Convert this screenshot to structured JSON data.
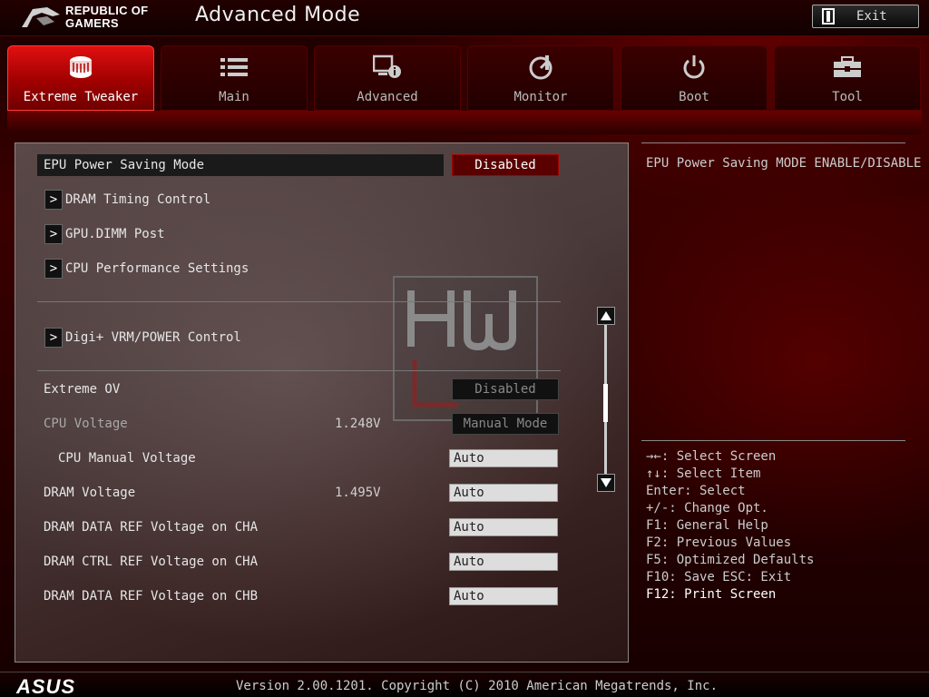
{
  "header": {
    "brand_line1": "REPUBLIC OF",
    "brand_line2": "GAMERS",
    "mode_title": "Advanced Mode",
    "exit_label": "Exit"
  },
  "tabs": [
    {
      "label": "Extreme Tweaker",
      "icon": "tweaker-icon",
      "active": true
    },
    {
      "label": "Main",
      "icon": "list-icon",
      "active": false
    },
    {
      "label": "Advanced",
      "icon": "advanced-icon",
      "active": false
    },
    {
      "label": "Monitor",
      "icon": "monitor-icon",
      "active": false
    },
    {
      "label": "Boot",
      "icon": "power-icon",
      "active": false
    },
    {
      "label": "Tool",
      "icon": "toolbox-icon",
      "active": false
    }
  ],
  "settings": {
    "epu_power": {
      "label": "EPU Power Saving Mode",
      "value": "Disabled"
    },
    "submenus": [
      {
        "label": "DRAM Timing Control"
      },
      {
        "label": "GPU.DIMM Post"
      },
      {
        "label": "CPU Performance Settings"
      },
      {
        "label": "Digi+ VRM/POWER Control"
      }
    ],
    "extreme_ov": {
      "label": "Extreme OV",
      "value": "Disabled"
    },
    "cpu_voltage": {
      "label": "CPU Voltage",
      "reading": "1.248V",
      "value": "Manual Mode"
    },
    "cpu_manual_voltage": {
      "label": "CPU Manual Voltage",
      "value": "Auto"
    },
    "dram_voltage": {
      "label": "DRAM Voltage",
      "reading": "1.495V",
      "value": "Auto"
    },
    "dram_data_ref_cha": {
      "label": "DRAM DATA REF Voltage on CHA",
      "value": "Auto"
    },
    "dram_ctrl_ref_cha": {
      "label": "DRAM CTRL REF Voltage on CHA",
      "value": "Auto"
    },
    "dram_data_ref_chb": {
      "label": "DRAM DATA REF Voltage on CHB",
      "value": "Auto"
    }
  },
  "help": {
    "description": "EPU Power Saving MODE ENABLE/DISABLE",
    "keys": [
      "→←: Select Screen",
      "↑↓: Select Item",
      "Enter: Select",
      "+/-: Change Opt.",
      "F1: General Help",
      "F2: Previous Values",
      "F5: Optimized Defaults",
      "F10: Save  ESC: Exit",
      "F12: Print Screen"
    ]
  },
  "footer": {
    "brand": "ASUS",
    "version": "Version 2.00.1201. Copyright (C) 2010 American Megatrends, Inc."
  },
  "colors": {
    "accent": "#e01010",
    "panel_bg": "#4a3a3a"
  }
}
